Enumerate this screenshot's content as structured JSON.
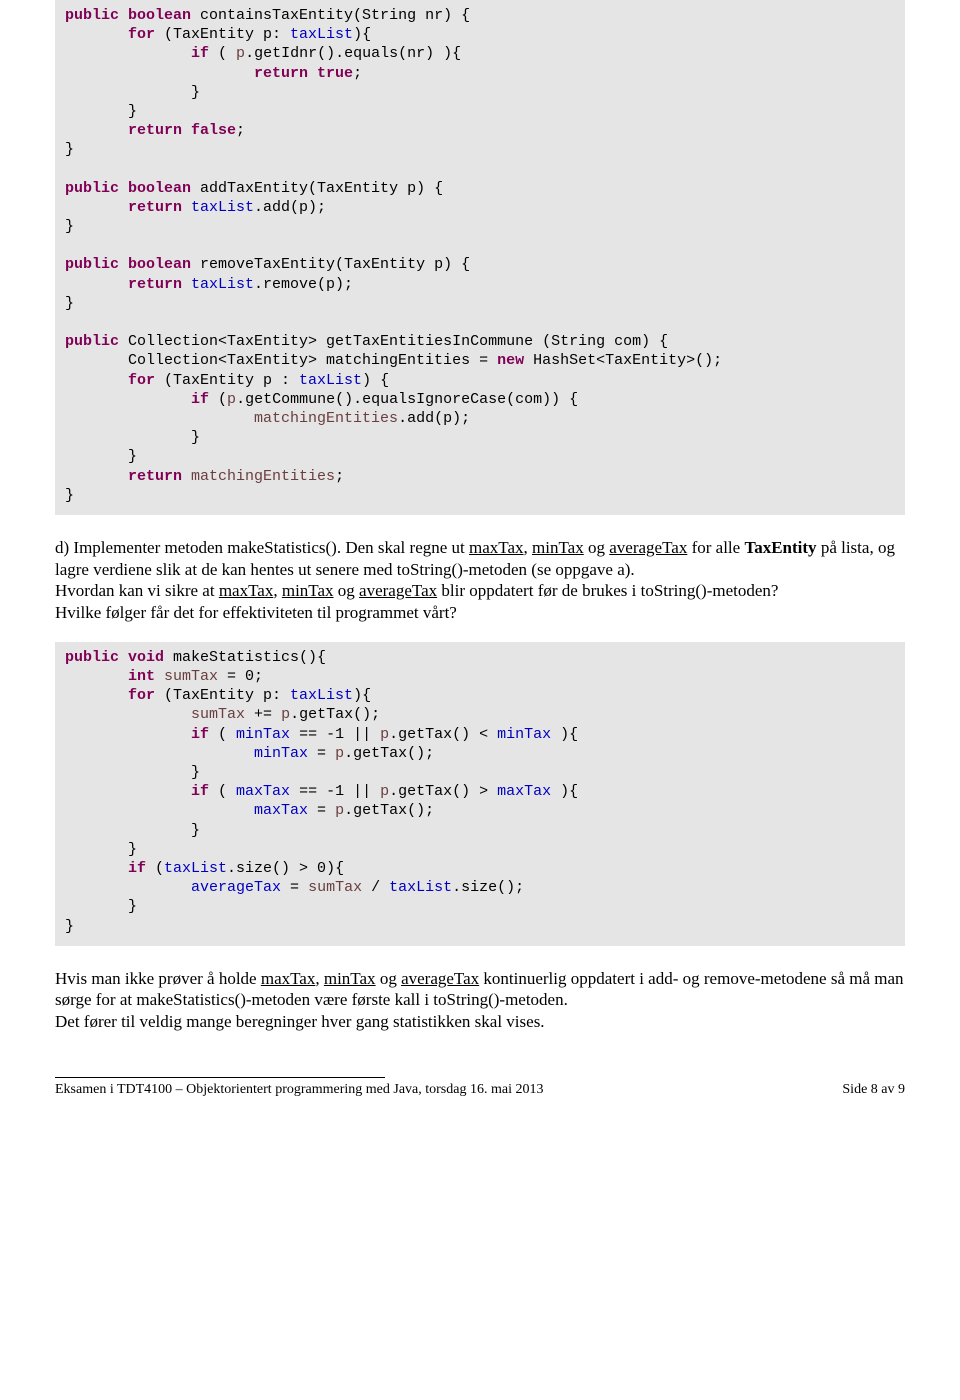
{
  "code1": {
    "l1a": "public",
    "l1b": " boolean",
    "l1c": " containsTaxEntity(String nr) {",
    "l2a": "       for",
    "l2b": " (TaxEntity p: ",
    "l2c": "taxList",
    "l2d": "){",
    "l3a": "              if",
    "l3b": " ( ",
    "l3c": "p",
    "l3d": ".getIdnr().equals(nr) ){",
    "l4a": "                     return",
    "l4b": " true",
    "l4c": ";",
    "l5": "              }",
    "l6": "       }",
    "l7a": "       return",
    "l7b": " false",
    "l7c": ";",
    "l8": "}",
    "l9": "",
    "l10a": "public",
    "l10b": " boolean",
    "l10c": " addTaxEntity(TaxEntity p) {",
    "l11a": "       return",
    "l11b": " taxList",
    "l11c": ".add(p);",
    "l12": "}",
    "l13": "",
    "l14a": "public",
    "l14b": " boolean",
    "l14c": " removeTaxEntity(TaxEntity p) {",
    "l15a": "       return",
    "l15b": " taxList",
    "l15c": ".remove(p);",
    "l16": "}",
    "l17": "",
    "l18a": "public",
    "l18b": " Collection<TaxEntity> getTaxEntitiesInCommune (String com) {",
    "l19a": "       Collection<TaxEntity> matchingEntities = ",
    "l19b": "new",
    "l19c": " HashSet<TaxEntity>();",
    "l20a": "       for",
    "l20b": " (TaxEntity p : ",
    "l20c": "taxList",
    "l20d": ") {",
    "l21a": "              if",
    "l21b": " (",
    "l21c": "p",
    "l21d": ".getCommune().equalsIgnoreCase(com)) {",
    "l22a": "                     ",
    "l22b": "matchingEntities",
    "l22c": ".add(p);",
    "l23": "              }",
    "l24": "       }",
    "l25a": "       return",
    "l25b": " matchingEntities",
    "l25c": ";",
    "l26": "}"
  },
  "para_d": "d) Implementer metoden makeStatistics(). Den skal regne ut maxTax, minTax og averageTax for alle TaxEntity på lista, og lagre verdiene slik at de kan hentes ut senere med toString()-metoden (se oppgave a).\nHvordan kan vi sikre at maxTax, minTax og averageTax blir oppdatert før de brukes i toString()-metoden?\nHvilke følger får det for effektiviteten til programmet vårt?",
  "code2": {
    "l1a": "public",
    "l1b": " void",
    "l1c": " makeStatistics(){",
    "l2a": "       int",
    "l2b": " ",
    "l2c": "sumTax",
    "l2d": " = 0;",
    "l3a": "       for",
    "l3b": " (TaxEntity p: ",
    "l3c": "taxList",
    "l3d": "){",
    "l4a": "              ",
    "l4b": "sumTax",
    "l4c": " += ",
    "l4d": "p",
    "l4e": ".getTax();",
    "l5a": "              if",
    "l5b": " ( ",
    "l5c": "minTax",
    "l5d": " == -1 || ",
    "l5e": "p",
    "l5f": ".getTax() < ",
    "l5g": "minTax",
    "l5h": " ){",
    "l6a": "                     ",
    "l6b": "minTax",
    "l6c": " = ",
    "l6d": "p",
    "l6e": ".getTax();",
    "l7": "              }",
    "l8a": "              if",
    "l8b": " ( ",
    "l8c": "maxTax",
    "l8d": " == -1 || ",
    "l8e": "p",
    "l8f": ".getTax() > ",
    "l8g": "maxTax",
    "l8h": " ){",
    "l9a": "                     ",
    "l9b": "maxTax",
    "l9c": " = ",
    "l9d": "p",
    "l9e": ".getTax();",
    "l10": "              }",
    "l11": "       }",
    "l12a": "       if",
    "l12b": " (",
    "l12c": "taxList",
    "l12d": ".size() > 0){",
    "l13a": "              ",
    "l13b": "averageTax",
    "l13c": " = ",
    "l13d": "sumTax",
    "l13e": " / ",
    "l13f": "taxList",
    "l13g": ".size();",
    "l14": "       }",
    "l15": "}"
  },
  "para_bottom": "Hvis man ikke prøver å holde maxTax, minTax og averageTax kontinuerlig oppdatert i add- og remove-metodene så må man sørge for at makeStatistics()-metoden være første kall i toString()-metoden.\nDet fører til veldig mange beregninger hver gang statistikken skal vises.",
  "footer": {
    "left": "Eksamen i TDT4100 – Objektorientert programmering med Java, torsdag 16. mai 2013",
    "right": "Side 8 av 9"
  }
}
